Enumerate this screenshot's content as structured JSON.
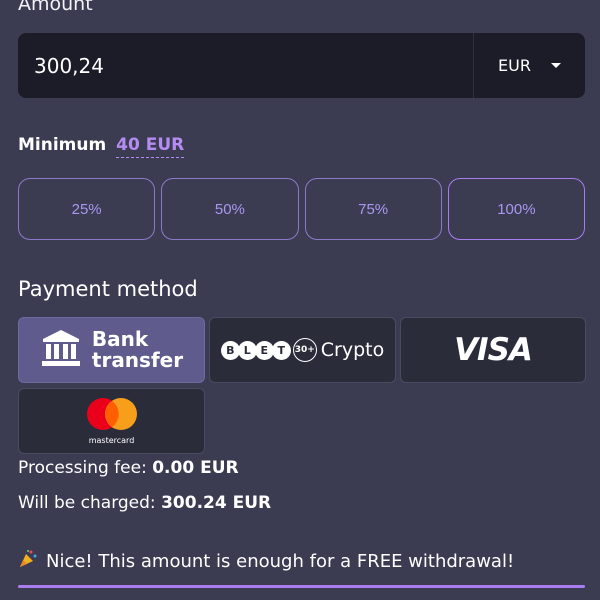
{
  "amount_section": {
    "label": "Amount",
    "value": "300,24",
    "currency": "EUR"
  },
  "minimum": {
    "label": "Minimum",
    "value": "40 EUR"
  },
  "percent_options": [
    {
      "label": "25%"
    },
    {
      "label": "50%"
    },
    {
      "label": "75%"
    },
    {
      "label": "100%",
      "active": true
    }
  ],
  "payment": {
    "title": "Payment method",
    "bank": {
      "line1": "Bank",
      "line2": "transfer",
      "icon": "bank-icon",
      "selected": true
    },
    "crypto": {
      "label": "Crypto",
      "count_badge": "30+",
      "coins": [
        "B",
        "L",
        "E",
        "T"
      ]
    },
    "visa": {
      "label": "VISA"
    },
    "mastercard": {
      "label": "mastercard"
    }
  },
  "fees": {
    "processing_label": "Processing fee:",
    "processing_value": "0.00 EUR",
    "charged_label": "Will be charged:",
    "charged_value": "300.24 EUR"
  },
  "notice": {
    "icon": "party-popper-icon",
    "text": "Nice! This amount is enough for a FREE withdrawal!"
  },
  "colors": {
    "background": "#3b3c52",
    "accent": "#a97cf0",
    "input_bg": "#1b1c28"
  }
}
